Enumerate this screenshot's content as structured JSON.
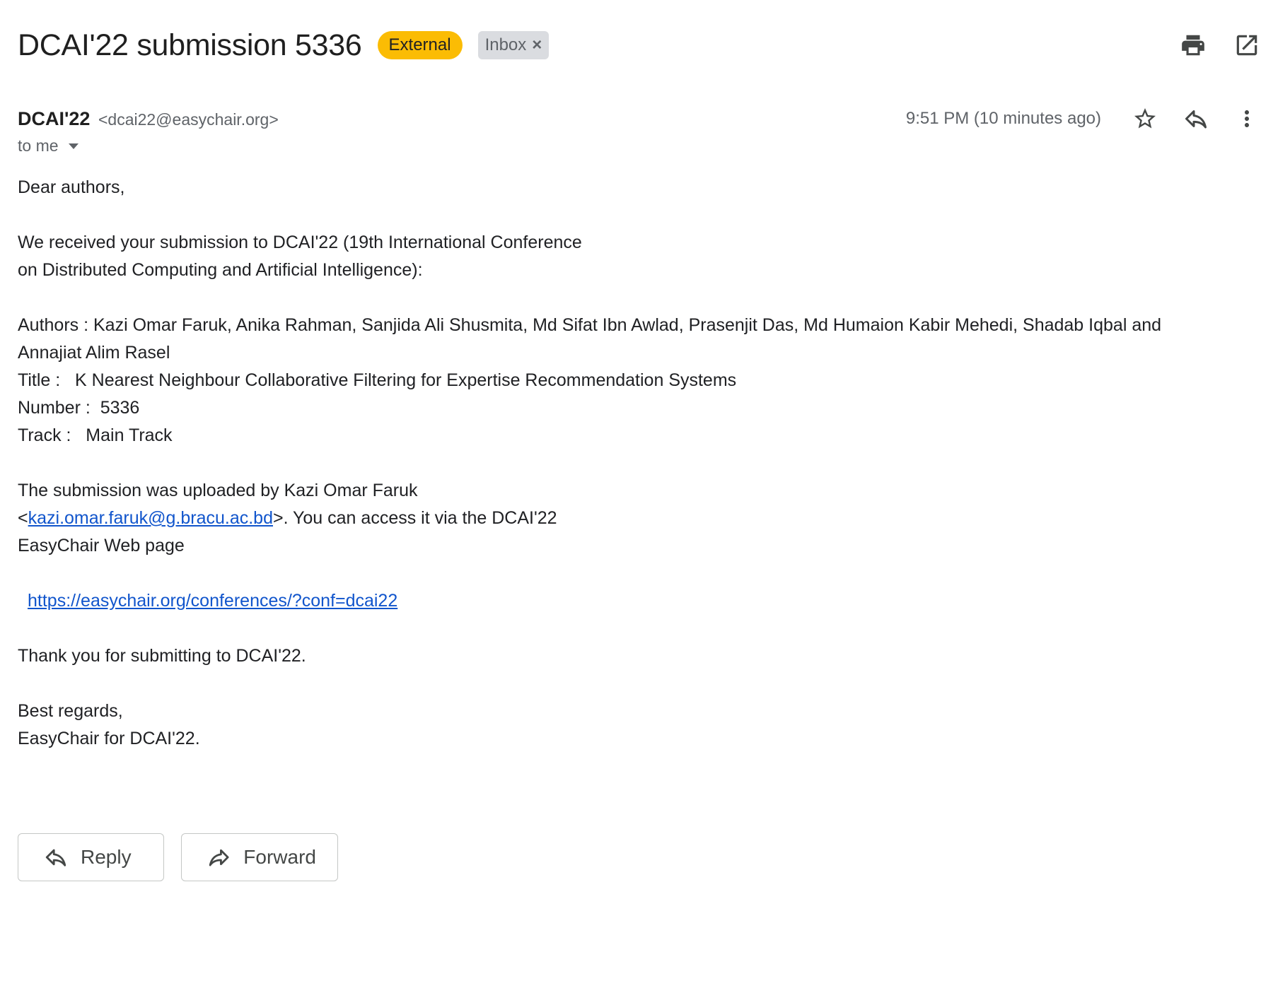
{
  "header": {
    "subject": "DCAI'22 submission 5336",
    "labels": [
      {
        "text": "External",
        "color": "#fbbc04"
      },
      {
        "text": "Inbox",
        "color": "#dadce0"
      }
    ],
    "icons": [
      "print-icon",
      "open-in-new-window-icon"
    ]
  },
  "message": {
    "sender_name": "DCAI'22",
    "sender_email": "<dcai22@easychair.org>",
    "recipient": "to me",
    "timestamp": "9:51 PM (10 minutes ago)",
    "icons": [
      "star-icon",
      "reply-icon",
      "more-vert-icon"
    ]
  },
  "body": {
    "greeting": "Dear authors,",
    "intro_line1": "We received your submission to DCAI'22 (19th International Conference",
    "intro_line2": "on Distributed Computing and Artificial Intelligence):",
    "authors_line1": "Authors : Kazi Omar Faruk, Anika Rahman, Sanjida Ali Shusmita, Md Sifat Ibn Awlad, Prasenjit Das, Md Humaion Kabir Mehedi, Shadab Iqbal and",
    "authors_line2": "Annajiat Alim Rasel",
    "title_line": "Title :   K Nearest Neighbour Collaborative Filtering for Expertise Recommendation Systems",
    "number_line": "Number :  5336",
    "track_line": "Track :   Main Track",
    "upload_line1": "The submission was uploaded by Kazi Omar Faruk",
    "upload_lt": "<",
    "upload_email": "kazi.omar.faruk@g.bracu.ac.bd",
    "upload_rest": ">. You can access it via the DCAI'22",
    "upload_line3": "EasyChair Web page",
    "conf_link": "https://easychair.org/conferences/?conf=dcai22",
    "thanks": "Thank you for submitting to DCAI'22.",
    "regards": "Best regards,",
    "signature": "EasyChair for DCAI'22."
  },
  "actions": {
    "reply_label": "Reply",
    "forward_label": "Forward"
  }
}
